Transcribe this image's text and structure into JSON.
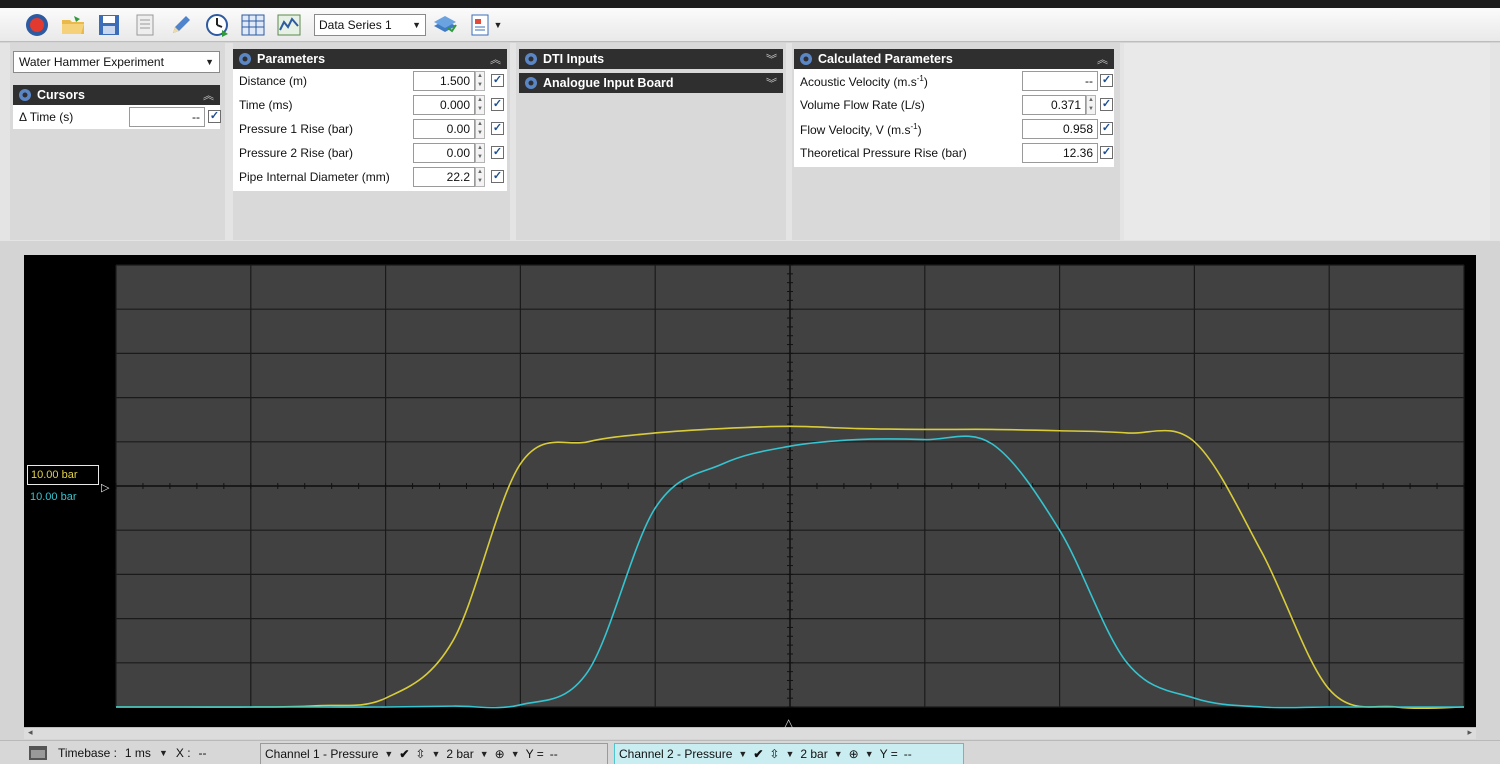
{
  "toolbar": {
    "icons": [
      "stop-record-icon",
      "open-folder-icon",
      "save-icon",
      "document-icon",
      "pencil-icon",
      "clock-icon",
      "table-icon",
      "chart-icon",
      "layers-icon",
      "report-icon"
    ],
    "series_value": "Data Series 1"
  },
  "experiment": {
    "value": "Water Hammer Experiment"
  },
  "cursors": {
    "title": "Cursors",
    "rows": [
      {
        "label": "Δ Time  (s)",
        "value": "--"
      }
    ]
  },
  "parameters": {
    "title": "Parameters",
    "rows": [
      {
        "label": "Distance  (m)",
        "value": "1.500"
      },
      {
        "label": "Time  (ms)",
        "value": "0.000"
      },
      {
        "label": "Pressure 1 Rise  (bar)",
        "value": "0.00"
      },
      {
        "label": "Pressure 2 Rise  (bar)",
        "value": "0.00"
      },
      {
        "label": "Pipe Internal Diameter  (mm)",
        "value": "22.2"
      }
    ]
  },
  "dti": {
    "inputs_title": "DTI Inputs",
    "board_title": "Analogue Input Board"
  },
  "calculated": {
    "title": "Calculated Parameters",
    "rows": [
      {
        "label_main": "Acoustic Velocity  (m.s",
        "label_sup": "-1",
        "label_tail": ")",
        "value": "--"
      },
      {
        "label_main": "Volume Flow Rate  (L/s)",
        "label_sup": "",
        "label_tail": "",
        "value": "0.371"
      },
      {
        "label_main": "Flow Velocity, V  (m.s",
        "label_sup": "-1",
        "label_tail": ")",
        "value": "0.958"
      },
      {
        "label_main": "Theoretical Pressure Rise  (bar)",
        "label_sup": "",
        "label_tail": "",
        "value": "12.36"
      }
    ]
  },
  "chart_labels": {
    "channel1_ref": "10.00 bar",
    "channel2_ref": "10.00 bar"
  },
  "chart_data": {
    "type": "line",
    "x": [
      0,
      0.5,
      1.0,
      1.5,
      2.0,
      2.5,
      3.0,
      3.5,
      4.0,
      4.5,
      5.0,
      5.5,
      6.0,
      6.5,
      7.0,
      7.5,
      8.0,
      8.5,
      9.0,
      9.5,
      10.0
    ],
    "xlim": [
      0,
      10
    ],
    "ylim": [
      -5,
      5
    ],
    "grid": true,
    "series": [
      {
        "name": "Channel 1 - Pressure",
        "color": "#d9cc3a",
        "values": [
          -5.0,
          -5.0,
          -5.0,
          -4.97,
          -4.8,
          -3.5,
          0.5,
          1.0,
          1.2,
          1.3,
          1.35,
          1.3,
          1.28,
          1.28,
          1.25,
          1.2,
          1.0,
          -1.5,
          -4.6,
          -5.0,
          -5.0
        ]
      },
      {
        "name": "Channel 2 - Pressure",
        "color": "#35c4d0",
        "values": [
          -5.0,
          -5.0,
          -5.0,
          -5.0,
          -5.0,
          -4.98,
          -4.95,
          -4.2,
          -0.5,
          0.5,
          0.9,
          1.05,
          1.05,
          0.95,
          -1.0,
          -4.0,
          -4.8,
          -5.0,
          -5.0,
          -5.0,
          -5.0
        ]
      }
    ]
  },
  "statusbar": {
    "timebase_label": "Timebase :",
    "timebase_value": "1 ms",
    "x_label": "X :",
    "x_value": "--",
    "channel1": {
      "name": "Channel 1 - Pressure",
      "scale": "2 bar",
      "y_label": "Y =",
      "y_value": "--"
    },
    "channel2": {
      "name": "Channel 2 - Pressure",
      "scale": "2 bar",
      "y_label": "Y =",
      "y_value": "--"
    }
  }
}
